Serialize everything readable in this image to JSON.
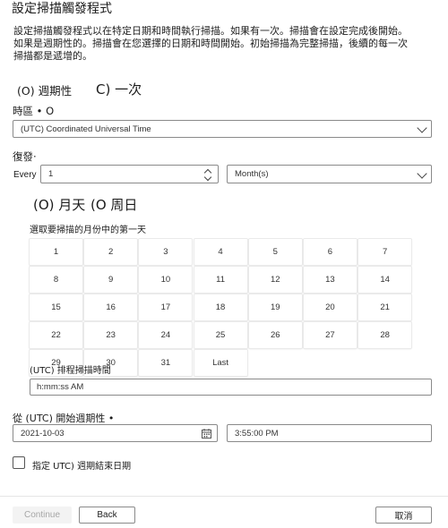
{
  "dialog": {
    "title": "設定掃描觸發程式",
    "description": "設定掃描觸發程式以在特定日期和時間執行掃描。如果有一次。掃描會在設定完成後開始。如果是週期性的。掃描會在您選擇的日期和時間開始。初始掃描為完整掃描，後續的每一次掃描都是遞增的。"
  },
  "recurrence_type": {
    "recurring_label": "(O) 週期性",
    "once_label": "C) 一次",
    "selected": "recurring"
  },
  "timezone": {
    "label": "時區 • O",
    "value": "(UTC) Coordinated Universal Time"
  },
  "repeat": {
    "label": "復發·",
    "every_label": "Every",
    "interval_value": "1",
    "unit_value": "Month(s)"
  },
  "month_mode": {
    "day_of_month_label": "(O) 月天",
    "day_of_week_label": "(O 周日",
    "selected": "day_of_month"
  },
  "day_picker": {
    "label": "選取要掃描的月份中的第一天",
    "days": [
      "1",
      "2",
      "3",
      "4",
      "5",
      "6",
      "7",
      "8",
      "9",
      "10",
      "11",
      "12",
      "13",
      "14",
      "15",
      "16",
      "17",
      "18",
      "19",
      "20",
      "21",
      "22",
      "23",
      "24",
      "25",
      "26",
      "27",
      "28",
      "29",
      "30",
      "31",
      "Last"
    ]
  },
  "schedule_time": {
    "label": "(UTC) 排程掃描時間",
    "value": "h:mm:ss AM"
  },
  "start": {
    "label": "從 (UTC) 開始週期性 •",
    "date_value": "2021-10-03",
    "time_value": "3:55:00 PM"
  },
  "end_date": {
    "label": "指定 UTC) 週期結束日期",
    "checked": false
  },
  "footer": {
    "continue_label": "Continue",
    "back_label": "Back",
    "cancel_label": "取消"
  }
}
